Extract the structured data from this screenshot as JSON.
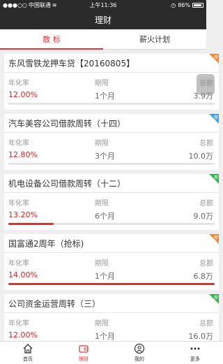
{
  "status": {
    "carrier": "中国联通",
    "time": "上午11:36",
    "battery": "86%"
  },
  "nav": {
    "title": "理财"
  },
  "tabs": [
    {
      "label": "散  标"
    },
    {
      "label": "薪火计划"
    }
  ],
  "labels": {
    "rate": "年化率",
    "period": "期限",
    "total": "总额"
  },
  "cards": [
    {
      "title": "东风雪铁龙押车贷【20160805】",
      "rate": "12.00%",
      "period": "1个月",
      "total": "3.9万",
      "badge": "荐",
      "badge_color": "#f5882a",
      "progress": 0.0
    },
    {
      "title": "汽车美容公司借款周转（十四）",
      "rate": "12.80%",
      "period": "3个月",
      "total": "10.0万",
      "badge": "荐",
      "badge_color": "#3aa0e8",
      "progress": 0.0
    },
    {
      "title": "机电设备公司借款周转（十二）",
      "rate": "13.20%",
      "period": "6个月",
      "total": "9.0万",
      "badge": "荐",
      "badge_color": "#2eb84a",
      "progress": 0.22
    },
    {
      "title": "国富通2周年（抢标)",
      "rate": "14.00%",
      "period": "1个月",
      "total": "6.8万",
      "badge": "荐",
      "badge_color": "#f5882a",
      "progress": 1.0
    },
    {
      "title": "公司资金运营周转（三）",
      "rate": "12.00%",
      "period": "1个月",
      "total": "16.0万",
      "badge": "荐",
      "badge_color": "#2eb84a",
      "progress": 0.0
    }
  ],
  "bottom_nav": [
    {
      "label": "首页",
      "icon": "home-icon"
    },
    {
      "label": "理财",
      "icon": "wallet-icon"
    },
    {
      "label": "我的",
      "icon": "user-icon"
    },
    {
      "label": "更多",
      "icon": "more-icon"
    }
  ],
  "colors": {
    "accent": "#e23a3a",
    "header": "#2b2b2b"
  }
}
